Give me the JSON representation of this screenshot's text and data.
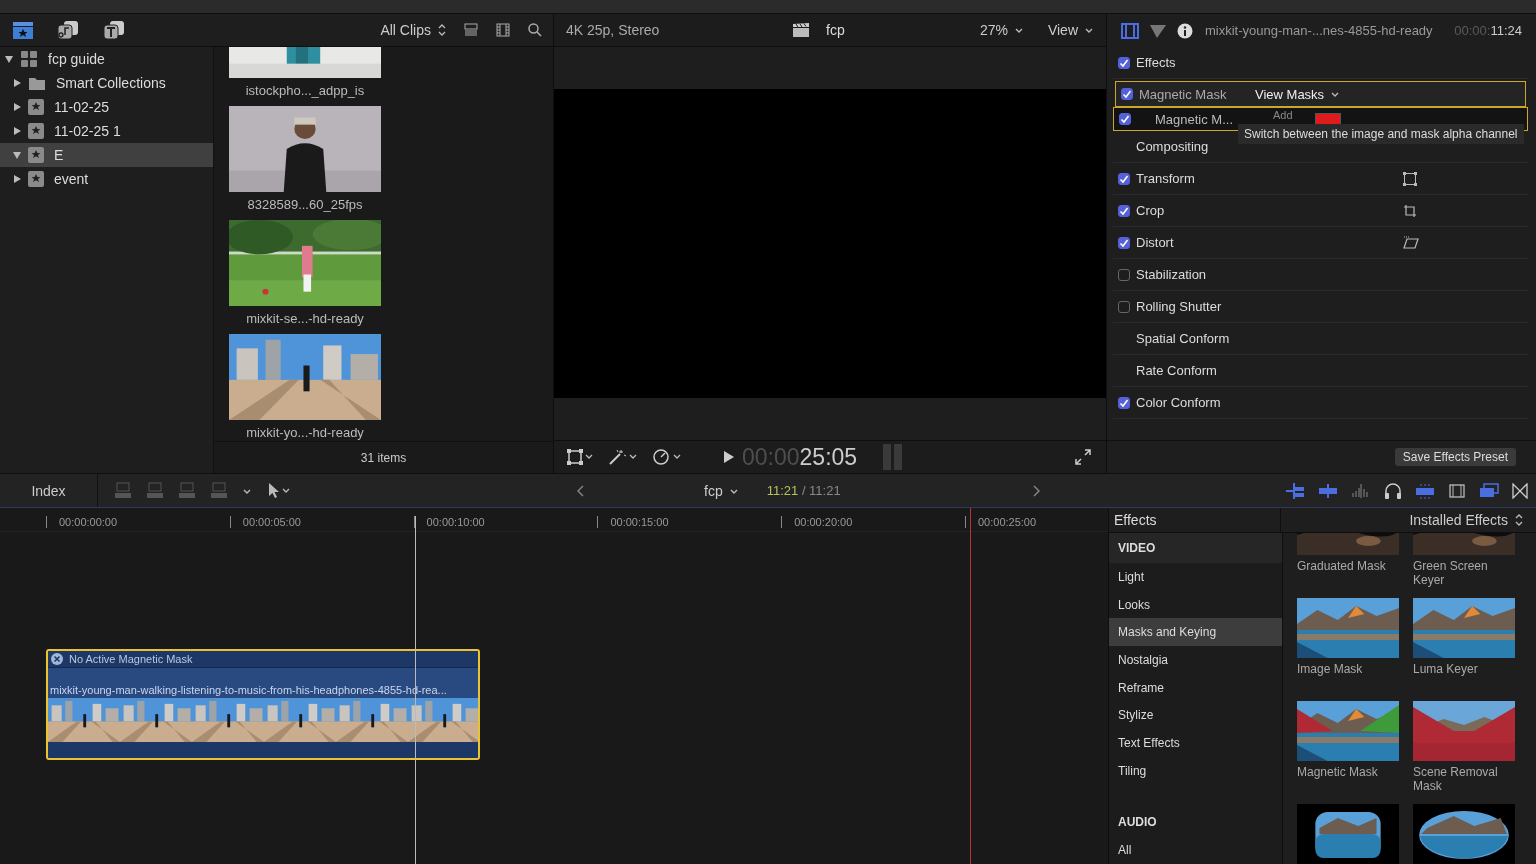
{
  "library_toolbar": {
    "clip_filter": "All Clips"
  },
  "sidebar": {
    "items": [
      {
        "label": "fcp guide",
        "kind": "library",
        "expanded": true,
        "selected": false,
        "children": [
          {
            "label": "Smart Collections",
            "kind": "folder",
            "expanded": false,
            "selected": false
          },
          {
            "label": "11-02-25",
            "kind": "event",
            "expanded": false,
            "selected": false
          },
          {
            "label": "11-02-25 1",
            "kind": "event",
            "expanded": false,
            "selected": false
          },
          {
            "label": "E",
            "kind": "event",
            "expanded": true,
            "selected": true
          },
          {
            "label": "event",
            "kind": "event",
            "expanded": false,
            "selected": false
          }
        ]
      }
    ]
  },
  "clips": {
    "items": [
      {
        "label": "istockpho..._adpp_is",
        "kind": "studio"
      },
      {
        "label": "8328589...60_25fps",
        "kind": "portrait"
      },
      {
        "label": "mixkit-se...-hd-ready",
        "kind": "golf"
      },
      {
        "label": "mixkit-yo...-hd-ready",
        "kind": "plaza"
      }
    ],
    "count": "31 items"
  },
  "viewer": {
    "format": "4K 25p, Stereo",
    "project": "fcp",
    "zoom": "27%",
    "view_menu": "View",
    "timecode_dim": "00:00",
    "timecode": "25:05"
  },
  "inspector": {
    "clip_name": "mixkit-young-man-...nes-4855-hd-ready",
    "timecode_dim": "00:00:",
    "timecode": "11:24",
    "rows": [
      {
        "label": "Effects",
        "kind": "toggle",
        "checked": true
      },
      {
        "label": "Magnetic Mask",
        "kind": "mask",
        "checked": true,
        "menu": "View Masks"
      },
      {
        "label": "Magnetic M...",
        "kind": "submask",
        "checked": true,
        "action": "Add"
      },
      {
        "label": "Compositing",
        "kind": "header"
      },
      {
        "label": "Transform",
        "kind": "transform",
        "checked": true
      },
      {
        "label": "Crop",
        "kind": "crop",
        "checked": true
      },
      {
        "label": "Distort",
        "kind": "distort",
        "checked": true
      },
      {
        "label": "Stabilization",
        "kind": "toggle",
        "checked": false
      },
      {
        "label": "Rolling Shutter",
        "kind": "toggle",
        "checked": false
      },
      {
        "label": "Spatial Conform",
        "kind": "header"
      },
      {
        "label": "Rate Conform",
        "kind": "header"
      },
      {
        "label": "Color Conform",
        "kind": "toggle",
        "checked": true
      }
    ],
    "tooltip": "Switch between the image and mask alpha channel",
    "save_button": "Save Effects Preset"
  },
  "timeline_toolbar": {
    "index": "Index",
    "project": "fcp",
    "position": "11:21",
    "duration": "/ 11:21"
  },
  "timeline": {
    "ruler": [
      "00:00:00:00",
      "00:00:05:00",
      "00:00:10:00",
      "00:00:15:00",
      "00:00:20:00",
      "00:00:25:00"
    ],
    "clip": {
      "mask_label": "No Active Magnetic Mask",
      "name": "mixkit-young-man-walking-listening-to-music-from-his-headphones-4855-hd-rea...",
      "selected": true
    }
  },
  "effects_browser": {
    "title": "Effects",
    "filter": "Installed Effects",
    "categories": [
      {
        "label": "VIDEO",
        "kind": "heading",
        "selected": false
      },
      {
        "label": "Light",
        "kind": "item",
        "selected": false
      },
      {
        "label": "Looks",
        "kind": "item",
        "selected": false
      },
      {
        "label": "Masks and Keying",
        "kind": "item",
        "selected": true
      },
      {
        "label": "Nostalgia",
        "kind": "item",
        "selected": false
      },
      {
        "label": "Reframe",
        "kind": "item",
        "selected": false
      },
      {
        "label": "Stylize",
        "kind": "item",
        "selected": false
      },
      {
        "label": "Text Effects",
        "kind": "item",
        "selected": false
      },
      {
        "label": "Tiling",
        "kind": "item",
        "selected": false
      },
      {
        "label": "AUDIO",
        "kind": "heading",
        "selected": false
      },
      {
        "label": "All",
        "kind": "item",
        "selected": false
      }
    ],
    "tiles": [
      {
        "label": "Graduated Mask",
        "kind": "dark"
      },
      {
        "label": "Green Screen Keyer",
        "kind": "dark"
      },
      {
        "label": "Image Mask",
        "kind": "lake"
      },
      {
        "label": "Luma Keyer",
        "kind": "lake"
      },
      {
        "label": "Magnetic Mask",
        "kind": "split"
      },
      {
        "label": "Scene Removal Mask",
        "kind": "red"
      },
      {
        "kind": "rounded"
      },
      {
        "kind": "oval"
      }
    ]
  }
}
